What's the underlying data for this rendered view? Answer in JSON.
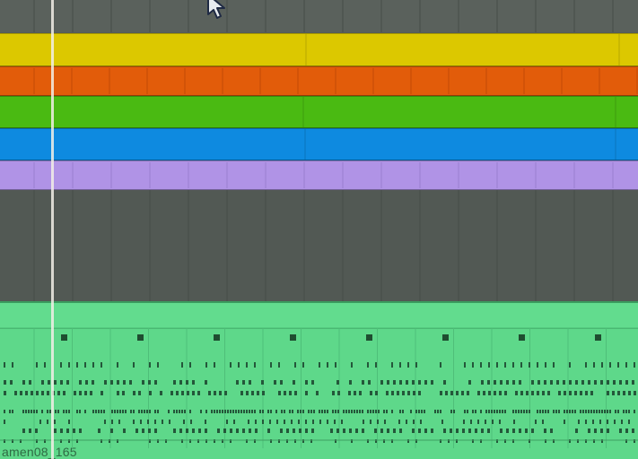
{
  "arrangement": {
    "clips": [
      {
        "color": "#dcc800",
        "name": ""
      },
      {
        "color": "#e25c0a",
        "name": ""
      },
      {
        "color": "#4aba12",
        "name": ""
      },
      {
        "color": "#0e8ae0",
        "name": ""
      },
      {
        "color": "#b093e6",
        "name": ""
      }
    ],
    "audio_clip": {
      "name": "amen08_165",
      "color": "#5ed88a"
    }
  },
  "icons": {
    "pointer": "mouse-pointer-icon"
  }
}
